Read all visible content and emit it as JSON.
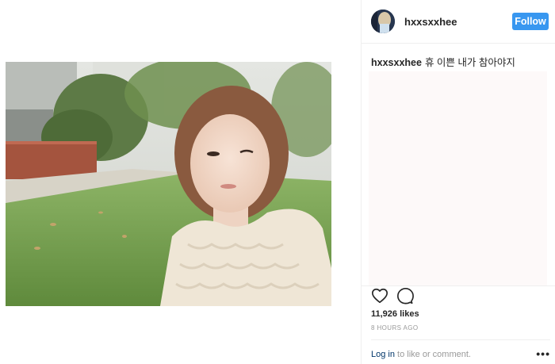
{
  "post": {
    "username": "hxxsxxhee",
    "follow_label": "Follow",
    "caption_user": "hxxsxxhee",
    "caption_text": "휴 이쁜 내가 참아야지",
    "likes": "11,926 likes",
    "timestamp": "8 HOURS AGO",
    "login_label": "Log in",
    "comment_prompt": " to like or comment.",
    "more_label": "•••"
  },
  "icons": {
    "like": "heart-icon",
    "comment": "comment-bubble-icon",
    "more": "more-options-icon"
  },
  "colors": {
    "follow_button": "#3897f0",
    "link": "#003569",
    "muted_text": "#999999",
    "primary_text": "#262626"
  }
}
